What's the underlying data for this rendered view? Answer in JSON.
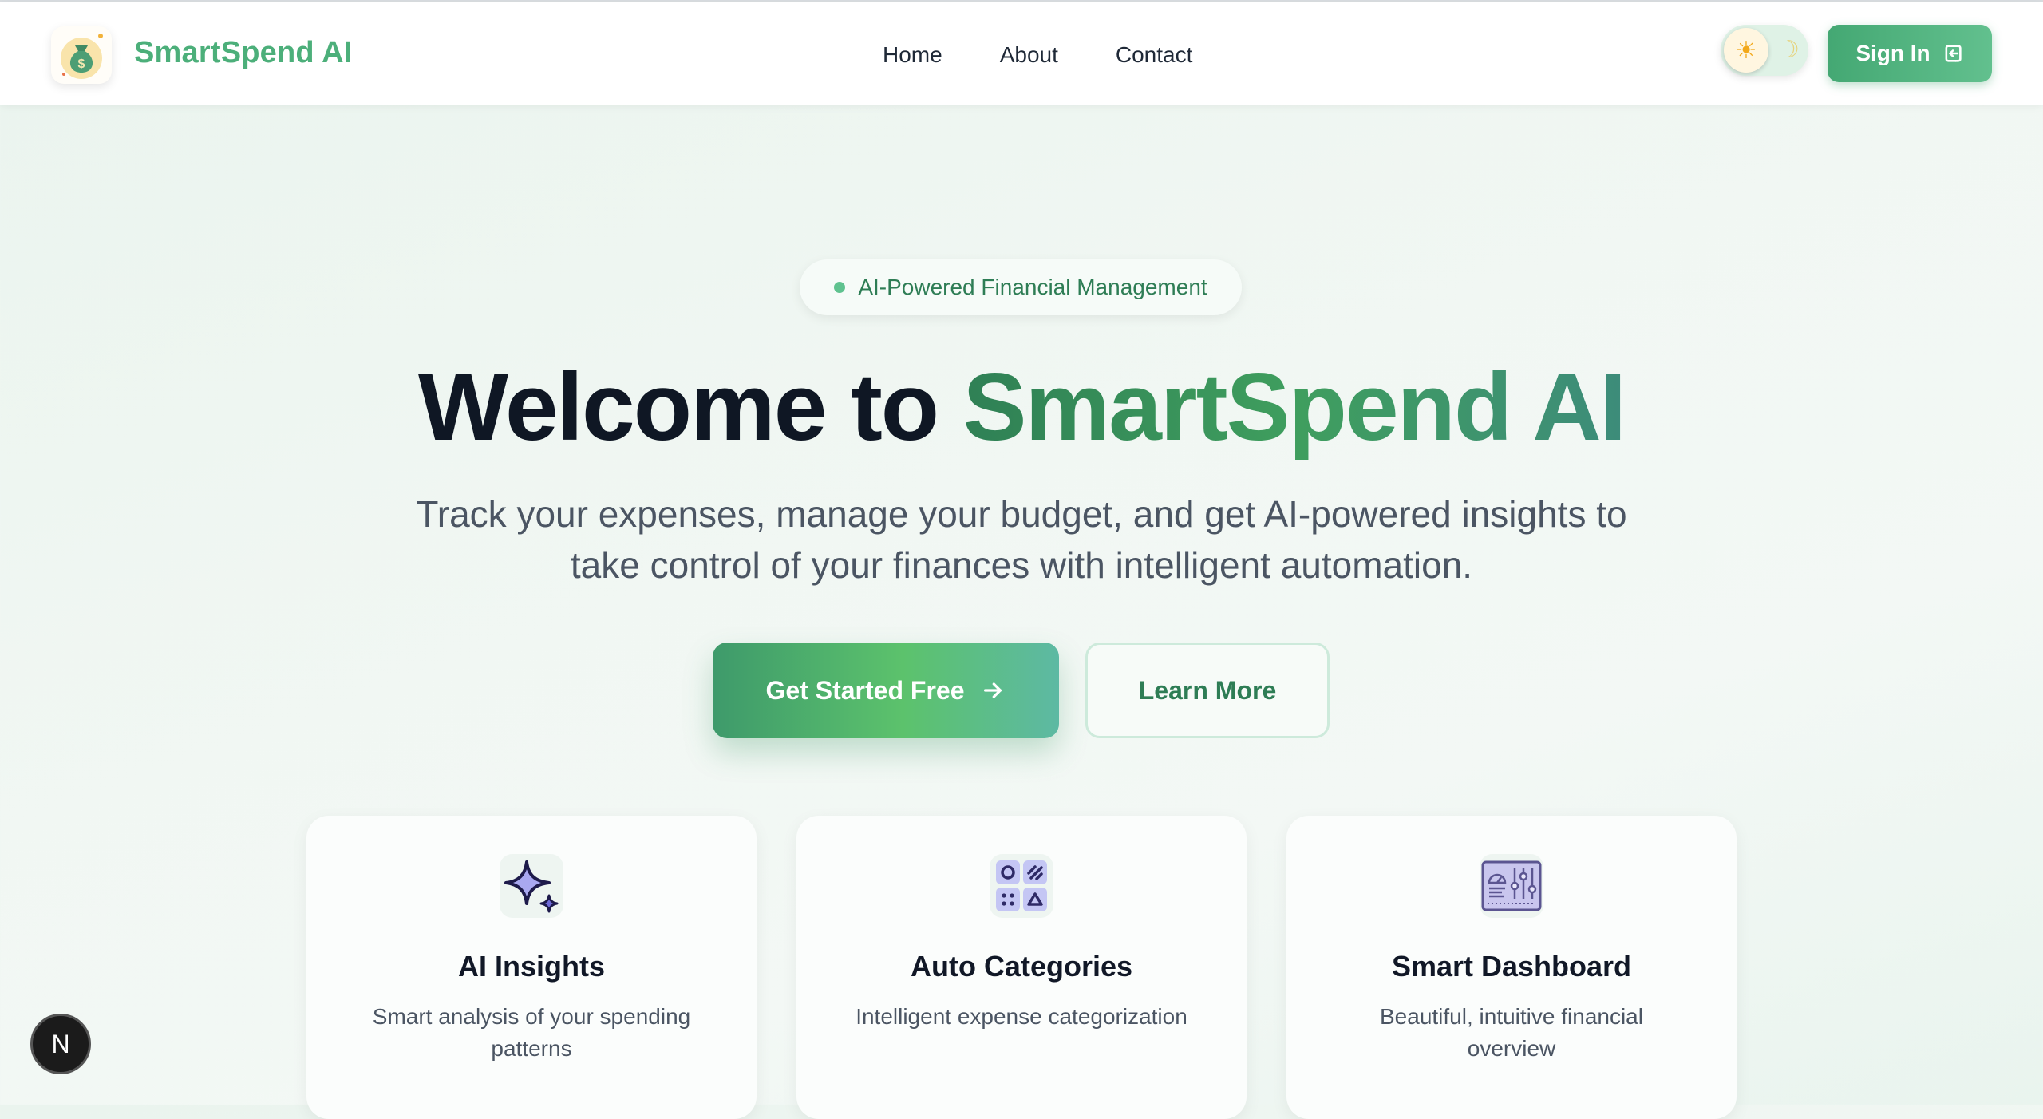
{
  "brand": {
    "name": "SmartSpend AI",
    "logo_icon": "money-bag-icon"
  },
  "nav": {
    "links": [
      "Home",
      "About",
      "Contact"
    ]
  },
  "theme_toggle": {
    "sun_icon": "☀",
    "moon_icon": "☽",
    "state": "light"
  },
  "signin": {
    "label": "Sign In",
    "icon": "sign-in-icon"
  },
  "hero": {
    "badge": "AI-Powered Financial Management",
    "title_prefix": "Welcome to ",
    "title_highlight": "SmartSpend AI",
    "subtitle_line1": "Track your expenses, manage your budget, and get AI-powered insights to",
    "subtitle_line2": "take control of your finances with intelligent automation.",
    "primary_cta": "Get Started Free",
    "secondary_cta": "Learn More"
  },
  "features": [
    {
      "title": "AI Insights",
      "description": "Smart analysis of your spending patterns",
      "icon": "sparkles-icon"
    },
    {
      "title": "Auto Categories",
      "description": "Intelligent expense categorization",
      "icon": "shapes-grid-icon"
    },
    {
      "title": "Smart Dashboard",
      "description": "Beautiful, intuitive financial overview",
      "icon": "control-panel-icon"
    }
  ],
  "dev_badge": {
    "label": "N"
  },
  "colors": {
    "accent": "#4caf7a",
    "accent_dark": "#2e7d55",
    "text_dark": "#0f1724",
    "muted": "#4b5563"
  }
}
